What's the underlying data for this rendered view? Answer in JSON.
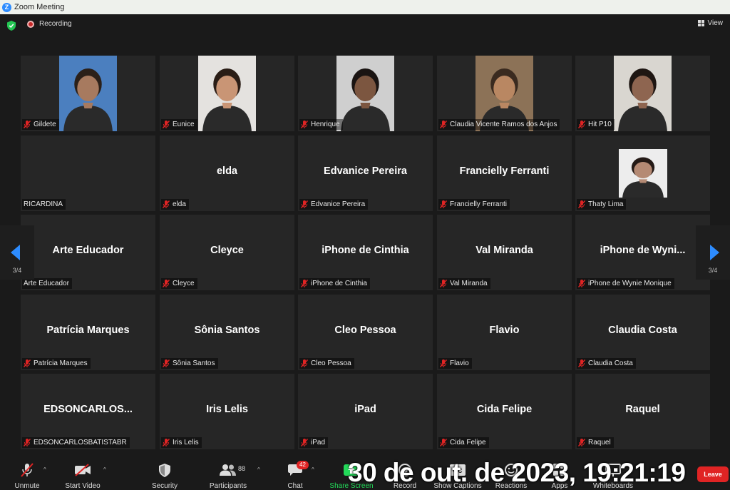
{
  "window": {
    "title": "Zoom Meeting"
  },
  "header": {
    "recording_label": "Recording",
    "view_label": "View"
  },
  "pagination": {
    "left_page": "3/4",
    "right_page": "3/4"
  },
  "tiles": [
    {
      "display": "",
      "name": "Gildete",
      "muted": true,
      "video": true,
      "skin": "#a77a5f",
      "bg": "#4b7fbf",
      "hair": "#2b2019"
    },
    {
      "display": "",
      "name": "Eunice",
      "muted": true,
      "video": true,
      "skin": "#c99575",
      "bg": "#e4e2df",
      "hair": "#2a1d16"
    },
    {
      "display": "",
      "name": "Henrique",
      "muted": true,
      "video": true,
      "skin": "#7c5640",
      "bg": "#cfcfcf",
      "hair": "#1a1412"
    },
    {
      "display": "",
      "name": "Claudia Vicente Ramos dos Anjos",
      "muted": true,
      "video": true,
      "skin": "#b98762",
      "bg": "#8c7257",
      "hair": "#3a2a1f"
    },
    {
      "display": "",
      "name": "Hit P10",
      "muted": true,
      "video": true,
      "skin": "#8e6550",
      "bg": "#d9d6d0",
      "hair": "#1e1612"
    },
    {
      "display": "",
      "name": "RICARDINA",
      "muted": false,
      "video": false
    },
    {
      "display": "elda",
      "name": "elda",
      "muted": true,
      "video": false
    },
    {
      "display": "Edvanice Pereira",
      "name": "Edvanice Pereira",
      "muted": true,
      "video": false
    },
    {
      "display": "Francielly Ferranti",
      "name": "Francielly Ferranti",
      "muted": true,
      "video": false
    },
    {
      "display": "",
      "name": "Thaty Lima",
      "muted": true,
      "video": true,
      "skin": "#b58a74",
      "bg": "#ededed",
      "hair": "#241a16"
    },
    {
      "display": "Arte Educador",
      "name": "Arte Educador",
      "muted": false,
      "video": false
    },
    {
      "display": "Cleyce",
      "name": "Cleyce",
      "muted": true,
      "video": false
    },
    {
      "display": "iPhone de Cinthia",
      "name": "iPhone de Cinthia",
      "muted": true,
      "video": false
    },
    {
      "display": "Val Miranda",
      "name": "Val Miranda",
      "muted": true,
      "video": false
    },
    {
      "display": "iPhone de Wyni...",
      "name": "iPhone de Wynie Monique",
      "muted": true,
      "video": false
    },
    {
      "display": "Patrícia Marques",
      "name": "Patrícia Marques",
      "muted": true,
      "video": false
    },
    {
      "display": "Sônia Santos",
      "name": "Sônia Santos",
      "muted": true,
      "video": false
    },
    {
      "display": "Cleo Pessoa",
      "name": "Cleo Pessoa",
      "muted": true,
      "video": false
    },
    {
      "display": "Flavio",
      "name": "Flavio",
      "muted": true,
      "video": false
    },
    {
      "display": "Claudia Costa",
      "name": "Claudia Costa",
      "muted": true,
      "video": false
    },
    {
      "display": "EDSONCARLOS...",
      "name": "EDSONCARLOSBATISTABR",
      "muted": true,
      "video": false
    },
    {
      "display": "Iris Lelis",
      "name": "Iris Lelis",
      "muted": true,
      "video": false
    },
    {
      "display": "iPad",
      "name": "iPad",
      "muted": true,
      "video": false
    },
    {
      "display": "Cida Felipe",
      "name": "Cida Felipe",
      "muted": true,
      "video": false
    },
    {
      "display": "Raquel",
      "name": "Raquel",
      "muted": true,
      "video": false
    }
  ],
  "toolbar": {
    "unmute": "Unmute",
    "start_video": "Start Video",
    "security": "Security",
    "participants": "Participants",
    "participants_count": "88",
    "chat": "Chat",
    "chat_badge": "42",
    "share_screen": "Share Screen",
    "record": "Record",
    "show_captions": "Show Captions",
    "reactions": "Reactions",
    "apps": "Apps",
    "whiteboards": "Whiteboards",
    "leave": "Leave"
  },
  "overlay": {
    "timestamp": "30 de out. de 2023, 19:21:19"
  },
  "colors": {
    "muted_icon": "#e02424",
    "accent": "#2d8cff",
    "share_green": "#23d959"
  }
}
